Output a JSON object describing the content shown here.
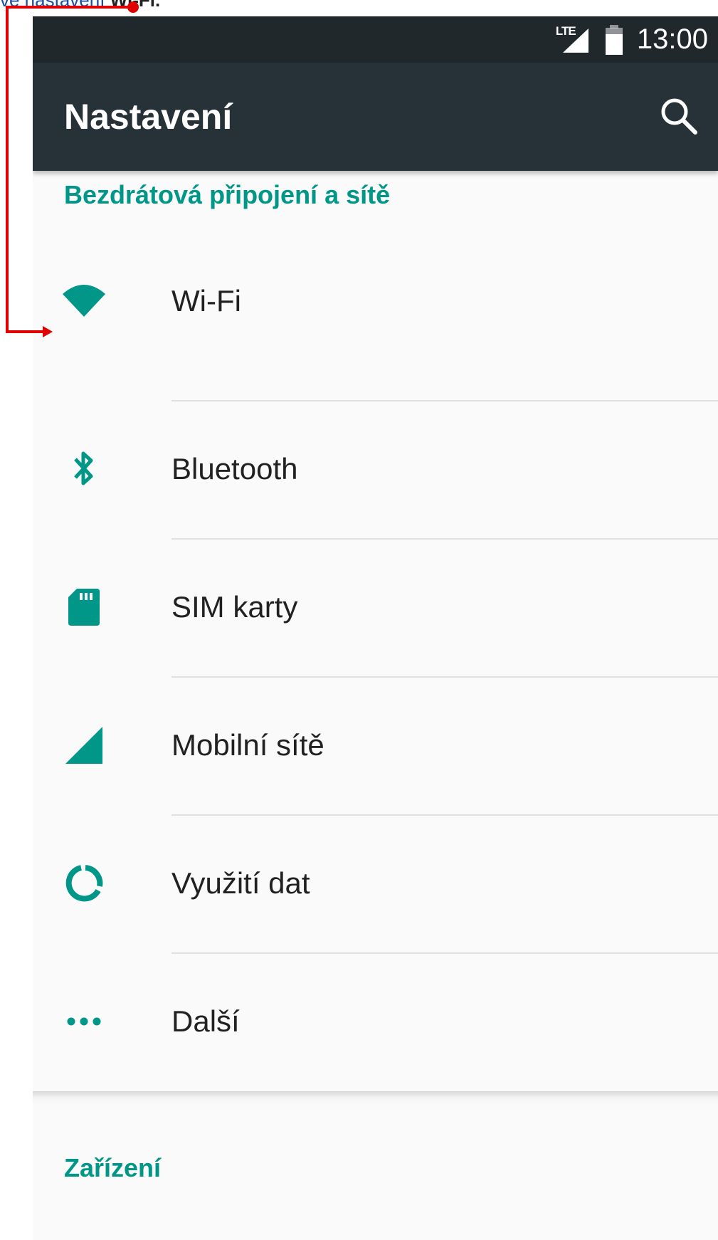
{
  "caption": {
    "text": "ve nastavení",
    "bold": "Wi-Fi."
  },
  "status_bar": {
    "network": "LTE",
    "time": "13:00"
  },
  "toolbar": {
    "title": "Nastavení"
  },
  "sections": {
    "wireless": {
      "header": "Bezdrátová připojení a sítě",
      "items": [
        {
          "label": "Wi-Fi",
          "icon": "wifi-icon"
        },
        {
          "label": "Bluetooth",
          "icon": "bluetooth-icon"
        },
        {
          "label": "SIM karty",
          "icon": "sim-card-icon"
        },
        {
          "label": "Mobilní sítě",
          "icon": "cellular-signal-icon"
        },
        {
          "label": "Využití dat",
          "icon": "data-usage-icon"
        },
        {
          "label": "Další",
          "icon": "more-dots-icon"
        }
      ]
    },
    "device": {
      "header": "Zařízení"
    }
  },
  "colors": {
    "accent": "#009688",
    "toolbar": "#263238",
    "status_bar": "#21282c",
    "background": "#fafafa",
    "annotation": "#e00000"
  }
}
